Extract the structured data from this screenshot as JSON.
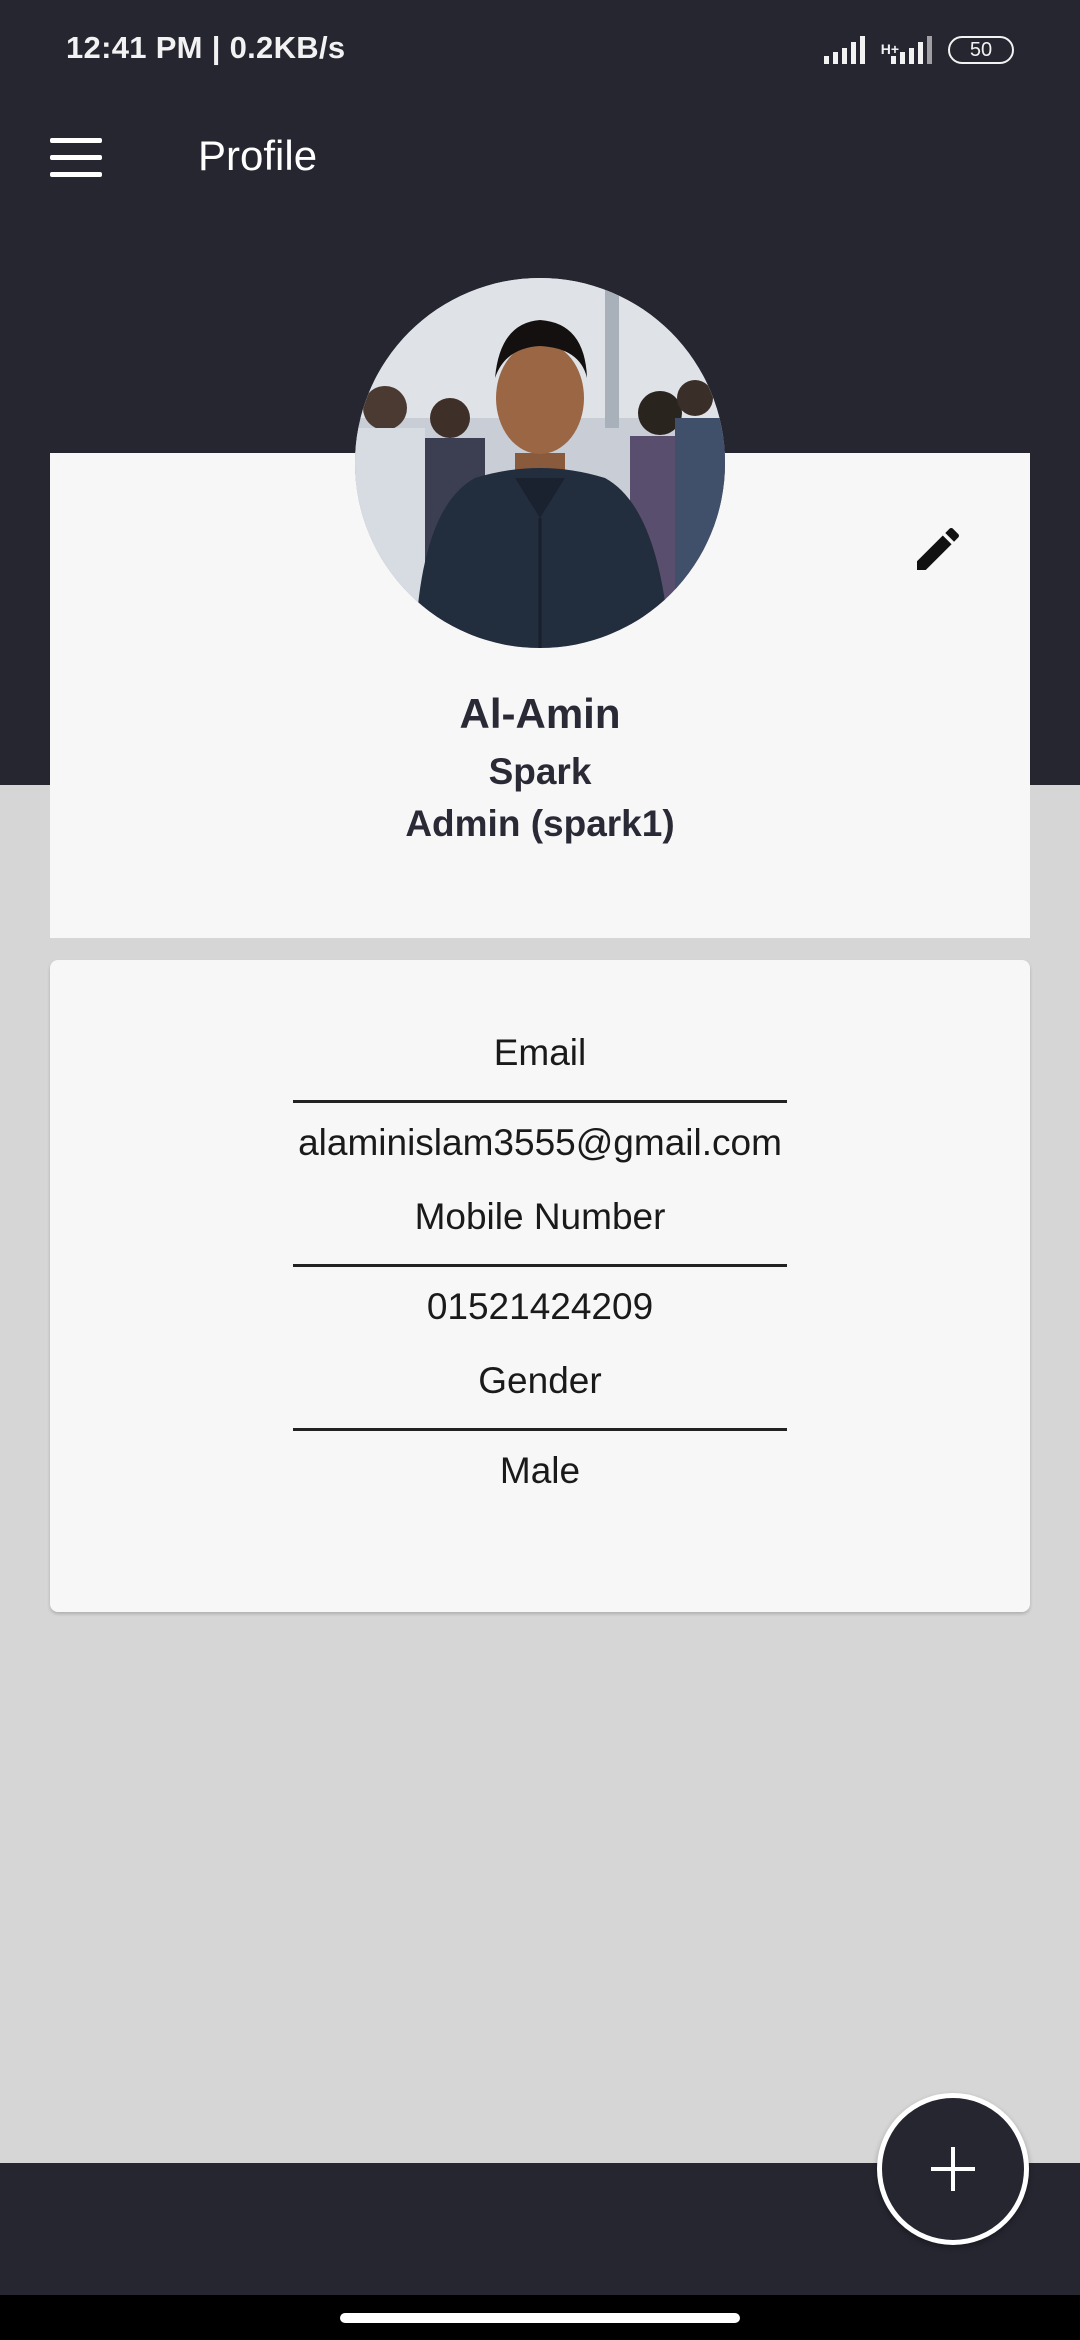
{
  "status_bar": {
    "time": "12:41 PM | 0.2KB/s",
    "network_type": "H+",
    "battery": "50"
  },
  "app_bar": {
    "title": "Profile",
    "menu_icon": "hamburger-menu-icon"
  },
  "profile": {
    "name": "Al-Amin",
    "company": "Spark",
    "role": "Admin (spark1)",
    "edit_icon": "pencil-icon"
  },
  "info": {
    "email_label": "Email",
    "email_value": "alaminislam3555@gmail.com",
    "mobile_label": "Mobile Number",
    "mobile_value": "01521424209",
    "gender_label": "Gender",
    "gender_value": "Male"
  },
  "fab": {
    "icon": "plus-icon"
  },
  "colors": {
    "header": "#262631",
    "card": "#f7f7f7",
    "background": "#d6d6d6"
  }
}
